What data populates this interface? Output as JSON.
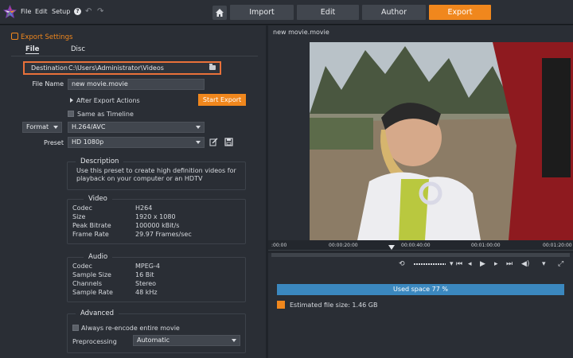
{
  "menu": {
    "file": "File",
    "edit": "Edit",
    "setup": "Setup",
    "help": "?"
  },
  "tabs": [
    {
      "label": "Import"
    },
    {
      "label": "Edit"
    },
    {
      "label": "Author"
    },
    {
      "label": "Export"
    }
  ],
  "export_settings": {
    "title": "Export Settings",
    "subtabs": [
      "File",
      "Disc"
    ],
    "destination_label": "Destination",
    "destination_value": "C:\\Users\\Administrator\\Videos",
    "file_name_label": "File Name",
    "file_name_value": "new movie.movie",
    "after_export_label": "After Export Actions",
    "start_export_label": "Start Export",
    "same_as_timeline_label": "Same as Timeline",
    "format_label": "Format",
    "format_value": "H.264/AVC",
    "preset_label": "Preset",
    "preset_value": "HD 1080p"
  },
  "description": {
    "title": "Description",
    "text": "Use this preset to create high definition videos for playback on your computer or an HDTV",
    "line1": "Use this preset to create high definition videos for",
    "line2": "playback on your computer or an HDTV"
  },
  "video": {
    "title": "Video",
    "rows": [
      {
        "k": "Codec",
        "v": "H264"
      },
      {
        "k": "Size",
        "v": "1920 x 1080"
      },
      {
        "k": "Peak Bitrate",
        "v": "100000 kBit/s"
      },
      {
        "k": "Frame Rate",
        "v": "29.97 Frames/sec"
      }
    ]
  },
  "audio": {
    "title": "Audio",
    "rows": [
      {
        "k": "Codec",
        "v": "MPEG-4"
      },
      {
        "k": "Sample Size",
        "v": "16 Bit"
      },
      {
        "k": "Channels",
        "v": "Stereo"
      },
      {
        "k": "Sample Rate",
        "v": "48 kHz"
      }
    ]
  },
  "advanced": {
    "title": "Advanced",
    "reencode_label": "Always re-encode entire movie",
    "preprocessing_label": "Preprocessing",
    "preprocessing_value": "Automatic"
  },
  "preview": {
    "title": "new movie.movie",
    "ticks": [
      ":00:00",
      "00:00:20:00",
      "00:00:40:00",
      "00:01:00:00",
      "00:01:20:00"
    ],
    "used_space": "Used space 77 %",
    "estimated": "Estimated file size: 1.46 GB"
  },
  "colors": {
    "accent": "#f0871d",
    "highlight": "#e9713a",
    "usedbar": "#3b88bf"
  }
}
